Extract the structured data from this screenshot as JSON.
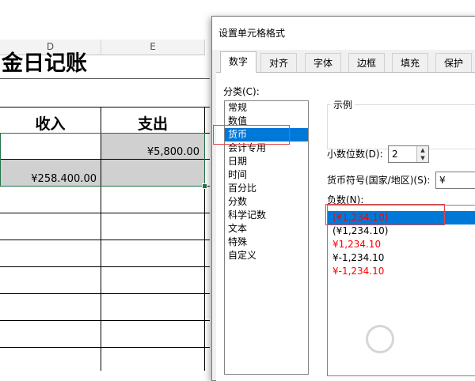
{
  "sheet": {
    "columns": [
      "D",
      "E"
    ],
    "title": "金日记账",
    "headers": {
      "income": "收入",
      "expense": "支出"
    },
    "cells": {
      "e_row1": "¥5,800.00",
      "d_row2": "¥258.400.00"
    }
  },
  "dialog": {
    "title": "设置单元格格式",
    "tabs": [
      {
        "label": "数字",
        "active": true
      },
      {
        "label": "对齐"
      },
      {
        "label": "字体"
      },
      {
        "label": "边框"
      },
      {
        "label": "填充"
      },
      {
        "label": "保护"
      }
    ],
    "category_label": "分类(C):",
    "categories": [
      "常规",
      "数值",
      "货币",
      "会计专用",
      "日期",
      "时间",
      "百分比",
      "分数",
      "科学记数",
      "文本",
      "特殊",
      "自定义"
    ],
    "selected_category": "货币",
    "sample_label": "示例",
    "decimal_label": "小数位数(D):",
    "decimal_value": "2",
    "currency_label": "货币符号(国家/地区)(S):",
    "currency_value": "¥",
    "negative_label": "负数(N):",
    "negative_options": [
      {
        "text": "(¥1,234.10)",
        "color": "#ff0000",
        "selected": true
      },
      {
        "text": "(¥1,234.10)",
        "color": "#000000"
      },
      {
        "text": "¥1,234.10",
        "color": "#ff0000"
      },
      {
        "text": "¥-1,234.10",
        "color": "#000000"
      },
      {
        "text": "¥-1,234.10",
        "color": "#ff0000"
      }
    ]
  },
  "colors": {
    "accent": "#0078d7",
    "selection_border": "#217346",
    "highlight_red": "#e04545"
  }
}
